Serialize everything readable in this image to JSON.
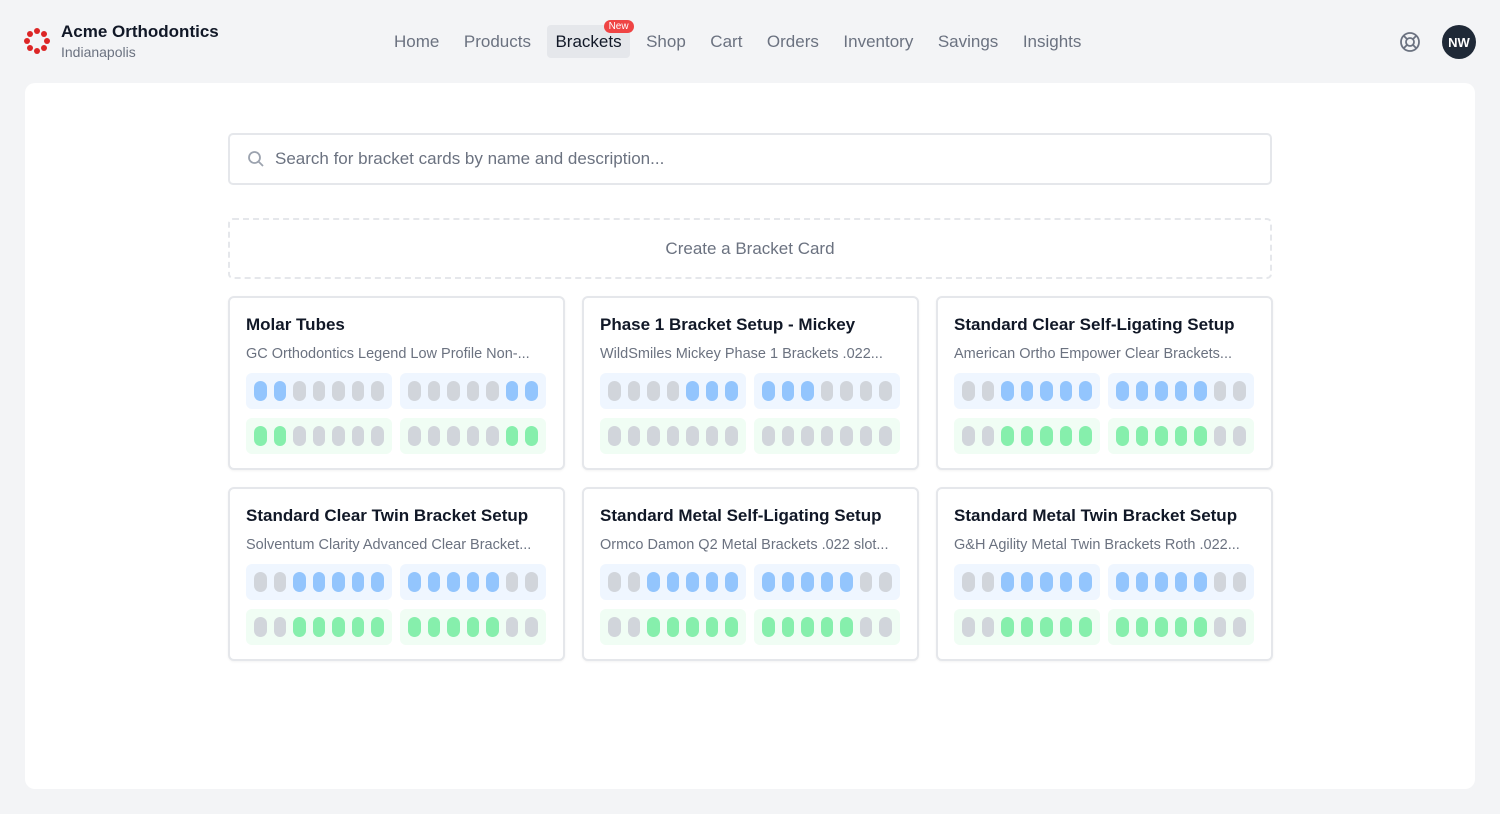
{
  "brand": {
    "name": "Acme Orthodontics",
    "location": "Indianapolis"
  },
  "nav": {
    "items": [
      {
        "label": "Home",
        "active": false
      },
      {
        "label": "Products",
        "active": false
      },
      {
        "label": "Brackets",
        "active": true,
        "badge": "New"
      },
      {
        "label": "Shop",
        "active": false
      },
      {
        "label": "Cart",
        "active": false
      },
      {
        "label": "Orders",
        "active": false
      },
      {
        "label": "Inventory",
        "active": false
      },
      {
        "label": "Savings",
        "active": false
      },
      {
        "label": "Insights",
        "active": false
      }
    ]
  },
  "user": {
    "initials": "NW"
  },
  "icons": {
    "help": "lifebuoy-icon",
    "search": "search-icon"
  },
  "colors": {
    "brand": "#dc2626",
    "upper_on": "#93c5fd",
    "lower_on": "#86efac",
    "off": "#d1d5db",
    "badge": "#ef4444"
  },
  "search": {
    "placeholder": "Search for bracket cards by name and description..."
  },
  "create": {
    "label": "Create a Bracket Card"
  },
  "cards": [
    {
      "title": "Molar Tubes",
      "description": "GC Orthodontics Legend Low Profile Non-...",
      "upper": [
        [
          1,
          1,
          0,
          0,
          0,
          0,
          0
        ],
        [
          0,
          0,
          0,
          0,
          0,
          1,
          1
        ]
      ],
      "lower": [
        [
          1,
          1,
          0,
          0,
          0,
          0,
          0
        ],
        [
          0,
          0,
          0,
          0,
          0,
          1,
          1
        ]
      ]
    },
    {
      "title": "Phase 1 Bracket Setup - Mickey",
      "description": "WildSmiles Mickey Phase 1 Brackets .022...",
      "upper": [
        [
          0,
          0,
          0,
          0,
          1,
          1,
          1
        ],
        [
          1,
          1,
          1,
          0,
          0,
          0,
          0
        ]
      ],
      "lower": [
        [
          0,
          0,
          0,
          0,
          0,
          0,
          0
        ],
        [
          0,
          0,
          0,
          0,
          0,
          0,
          0
        ]
      ]
    },
    {
      "title": "Standard Clear Self-Ligating Setup",
      "description": "American Ortho Empower Clear Brackets...",
      "upper": [
        [
          0,
          0,
          1,
          1,
          1,
          1,
          1
        ],
        [
          1,
          1,
          1,
          1,
          1,
          0,
          0
        ]
      ],
      "lower": [
        [
          0,
          0,
          1,
          1,
          1,
          1,
          1
        ],
        [
          1,
          1,
          1,
          1,
          1,
          0,
          0
        ]
      ]
    },
    {
      "title": "Standard Clear Twin Bracket Setup",
      "description": "Solventum Clarity Advanced Clear Bracket...",
      "upper": [
        [
          0,
          0,
          1,
          1,
          1,
          1,
          1
        ],
        [
          1,
          1,
          1,
          1,
          1,
          0,
          0
        ]
      ],
      "lower": [
        [
          0,
          0,
          1,
          1,
          1,
          1,
          1
        ],
        [
          1,
          1,
          1,
          1,
          1,
          0,
          0
        ]
      ]
    },
    {
      "title": "Standard Metal Self-Ligating Setup",
      "description": "Ormco Damon Q2 Metal Brackets .022 slot...",
      "upper": [
        [
          0,
          0,
          1,
          1,
          1,
          1,
          1
        ],
        [
          1,
          1,
          1,
          1,
          1,
          0,
          0
        ]
      ],
      "lower": [
        [
          0,
          0,
          1,
          1,
          1,
          1,
          1
        ],
        [
          1,
          1,
          1,
          1,
          1,
          0,
          0
        ]
      ]
    },
    {
      "title": "Standard Metal Twin Bracket Setup",
      "description": "G&H Agility Metal Twin Brackets Roth .022...",
      "upper": [
        [
          0,
          0,
          1,
          1,
          1,
          1,
          1
        ],
        [
          1,
          1,
          1,
          1,
          1,
          0,
          0
        ]
      ],
      "lower": [
        [
          0,
          0,
          1,
          1,
          1,
          1,
          1
        ],
        [
          1,
          1,
          1,
          1,
          1,
          0,
          0
        ]
      ]
    }
  ]
}
